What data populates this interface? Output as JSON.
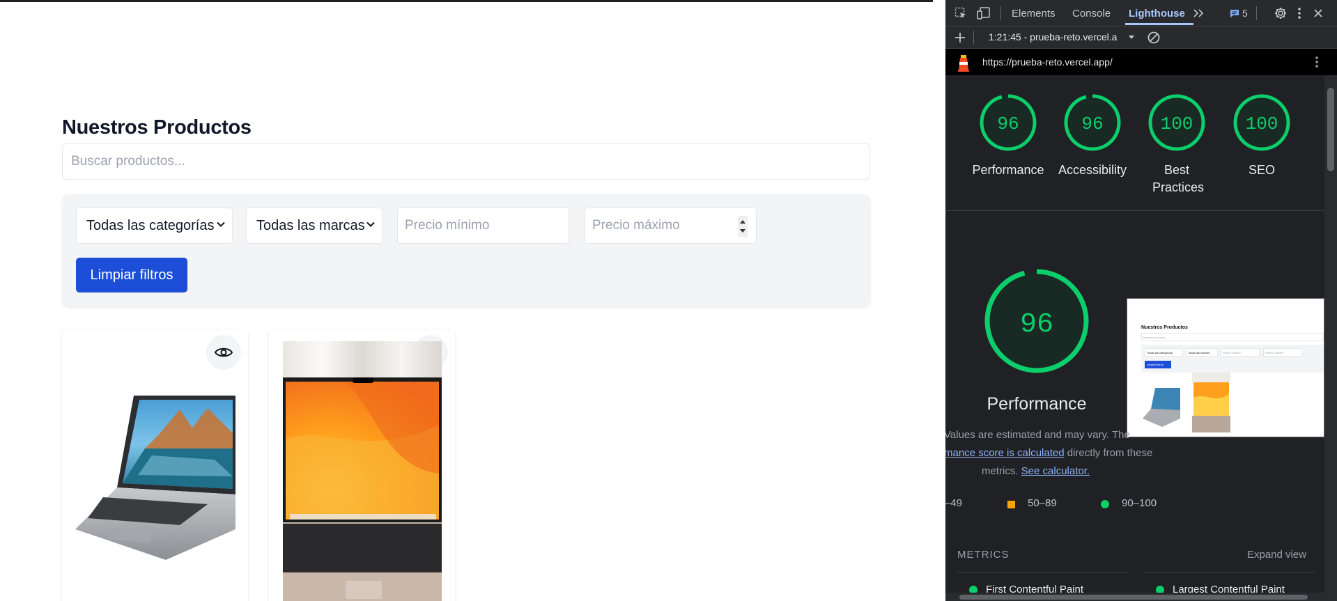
{
  "page": {
    "title": "Nuestros Productos",
    "search_placeholder": "Buscar productos...",
    "filters": {
      "category_selected": "Todas las categorías",
      "brand_selected": "Todas las marcas",
      "min_price_placeholder": "Precio mínimo",
      "max_price_placeholder": "Precio máximo",
      "clear_label": "Limpiar filtros"
    },
    "products": [
      {
        "image": "laptop-image"
      },
      {
        "image": "macbook-image"
      }
    ]
  },
  "devtools": {
    "tabs": [
      "Elements",
      "Console",
      "Lighthouse"
    ],
    "active_tab": "Lighthouse",
    "issues_count": "5",
    "report_time": "1:21:45 - prueba-reto.vercel.a",
    "url": "https://prueba-reto.vercel.app/",
    "scores": [
      {
        "value": "96",
        "label": "Performance"
      },
      {
        "value": "96",
        "label": "Accessibility"
      },
      {
        "value": "100",
        "label": "Best Practices"
      },
      {
        "value": "100",
        "label": "SEO"
      }
    ],
    "main_score": {
      "value": "96",
      "label": "Performance"
    },
    "note_part1": "Values are estimated and may vary. The",
    "note_link": "mance score is calculated",
    "note_part2": "directly from these",
    "note_part3": "metrics.",
    "see_calculator": "See calculator.",
    "legend": [
      {
        "range": "–49",
        "color": "#ff4e42"
      },
      {
        "range": "50–89",
        "color": "#ffa400"
      },
      {
        "range": "90–100",
        "color": "#0cce6b"
      }
    ],
    "metrics_title": "METRICS",
    "expand_view": "Expand view",
    "metrics": [
      "First Contentful Paint",
      "Largest Contentful Paint"
    ],
    "colors": {
      "pass": "#0cce6b",
      "accent": "#a8c7fa",
      "background": "#202124"
    },
    "thumbnail": {
      "title": "Nuestros Productos",
      "search": "Buscar productos...",
      "category": "Todas las categorías",
      "brand": "Todas las marcas",
      "min": "Precio mínimo",
      "max": "Precio máximo",
      "clear": "Limpiar filtros"
    }
  }
}
